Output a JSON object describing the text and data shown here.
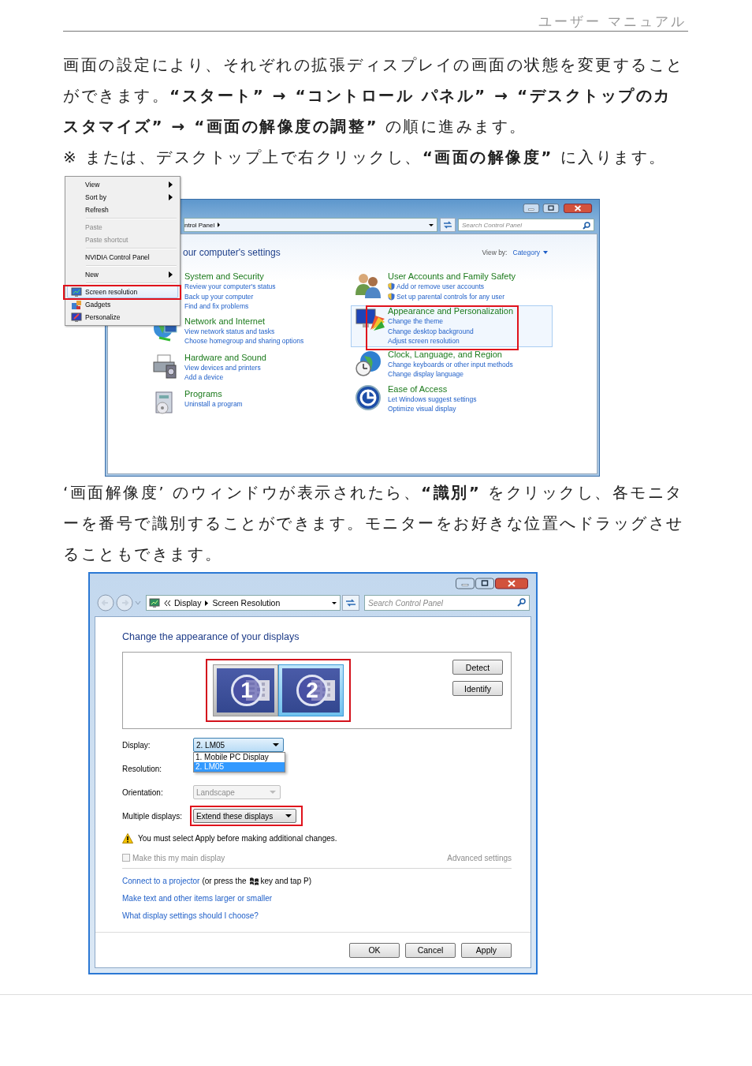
{
  "header": {
    "title": "ユーザー マニュアル"
  },
  "intro": [
    "画面の設定により、それぞれの拡張ディスプレイの画面の状態を変更することができます。**“スタート” → “コントロール パネル” → “デスクトップのカスタマイズ” → “画面の解像度の調整”** の順に進みます。",
    "※ または、デスクトップ上で右クリックし、**“画面の解像度”** に入ります。"
  ],
  "control_panel_screenshot": {
    "context_menu": [
      {
        "kind": "item",
        "label": "View",
        "submenu": true,
        "disabled": false,
        "selected": false
      },
      {
        "kind": "item",
        "label": "Sort by",
        "submenu": true,
        "disabled": false,
        "selected": false
      },
      {
        "kind": "item",
        "label": "Refresh",
        "submenu": false,
        "disabled": false,
        "selected": false
      },
      {
        "kind": "separator"
      },
      {
        "kind": "item",
        "label": "Paste",
        "submenu": false,
        "disabled": true,
        "selected": false
      },
      {
        "kind": "item",
        "label": "Paste shortcut",
        "submenu": false,
        "disabled": true,
        "selected": false
      },
      {
        "kind": "separator"
      },
      {
        "kind": "item",
        "label": "NVIDIA Control Panel",
        "submenu": false,
        "disabled": false,
        "selected": false
      },
      {
        "kind": "separator"
      },
      {
        "kind": "item",
        "label": "New",
        "submenu": true,
        "disabled": false,
        "selected": false
      },
      {
        "kind": "separator"
      },
      {
        "kind": "icon_item",
        "label": "Screen resolution",
        "submenu": false,
        "disabled": false,
        "selected": true
      },
      {
        "kind": "icon_item",
        "label": "Gadgets",
        "submenu": false,
        "disabled": false,
        "selected": false
      },
      {
        "kind": "icon_item",
        "label": "Personalize",
        "submenu": false,
        "disabled": false,
        "selected": false
      }
    ],
    "menu_callout": true,
    "breadcrumb": "ntrol Panel",
    "search": {
      "placeholder": "Search Control Panel"
    },
    "heading": "our computer's settings",
    "view_by": {
      "label": "View by:",
      "value": "Category"
    },
    "category_callout": true,
    "columns": [
      [
        {
          "title": "System and Security",
          "selected": false,
          "links": [
            {
              "text": "Review your computer's status",
              "shield": false
            },
            {
              "text": "Back up your computer",
              "shield": false
            },
            {
              "text": "Find and fix problems",
              "shield": false
            }
          ]
        },
        {
          "title": "Network and Internet",
          "selected": false,
          "links": [
            {
              "text": "View network status and tasks",
              "shield": false
            },
            {
              "text": "Choose homegroup and sharing options",
              "shield": false
            }
          ]
        },
        {
          "title": "Hardware and Sound",
          "selected": false,
          "links": [
            {
              "text": "View devices and printers",
              "shield": false
            },
            {
              "text": "Add a device",
              "shield": false
            }
          ]
        },
        {
          "title": "Programs",
          "selected": false,
          "links": [
            {
              "text": "Uninstall a program",
              "shield": false
            }
          ]
        }
      ],
      [
        {
          "title": "User Accounts and Family Safety",
          "selected": false,
          "links": [
            {
              "text": "Add or remove user accounts",
              "shield": true
            },
            {
              "text": "Set up parental controls for any user",
              "shield": true
            }
          ]
        },
        {
          "title": "Appearance and Personalization",
          "selected": true,
          "links": [
            {
              "text": "Change the theme",
              "shield": false
            },
            {
              "text": "Change desktop background",
              "shield": false
            },
            {
              "text": "Adjust screen resolution",
              "shield": false
            }
          ]
        },
        {
          "title": "Clock, Language, and Region",
          "selected": false,
          "links": [
            {
              "text": "Change keyboards or other input methods",
              "shield": false
            },
            {
              "text": "Change display language",
              "shield": false
            }
          ]
        },
        {
          "title": "Ease of Access",
          "selected": false,
          "links": [
            {
              "text": "Let Windows suggest settings",
              "shield": false
            },
            {
              "text": "Optimize visual display",
              "shield": false
            }
          ]
        }
      ]
    ]
  },
  "instruction": "‘画面解像度’ のウィンドウが表示されたら、**“識別”** をクリックし、各モニターを番号で識別することができます。モニターをお好きな位置へドラッグさせることもできます。",
  "screen_resolution_screenshot": {
    "breadcrumb": [
      "Display",
      "Screen Resolution"
    ],
    "search": {
      "placeholder": "Search Control Panel"
    },
    "heading": "Change the appearance of your displays",
    "monitors": [
      {
        "number": "1",
        "selected": false
      },
      {
        "number": "2",
        "selected": true
      }
    ],
    "monitors_callout": true,
    "side_buttons": [
      "Detect",
      "Identify"
    ],
    "display": {
      "label": "Display:",
      "value": "2. LM05",
      "options": [
        {
          "label": "1. Mobile PC Display",
          "selected": false
        },
        {
          "label": "2. LM05",
          "selected": true
        }
      ]
    },
    "resolution": {
      "label": "Resolution:"
    },
    "orientation": {
      "label": "Orientation:",
      "value": "Landscape",
      "disabled": true
    },
    "multiple_displays": {
      "label": "Multiple displays:",
      "value": "Extend these displays",
      "callout": true
    },
    "warning": "You must select Apply before making additional changes.",
    "main_display": {
      "label": "Make this my main display",
      "checked": false,
      "disabled": true
    },
    "advanced_settings": {
      "text": "Advanced settings",
      "disabled": true
    },
    "projector": {
      "link": "Connect to a projector",
      "before_key": "(or press the",
      "after_key": "key and tap P)"
    },
    "links": [
      "Make text and other items larger or smaller",
      "What display settings should I choose?"
    ],
    "buttons": [
      "OK",
      "Cancel",
      "Apply"
    ]
  }
}
